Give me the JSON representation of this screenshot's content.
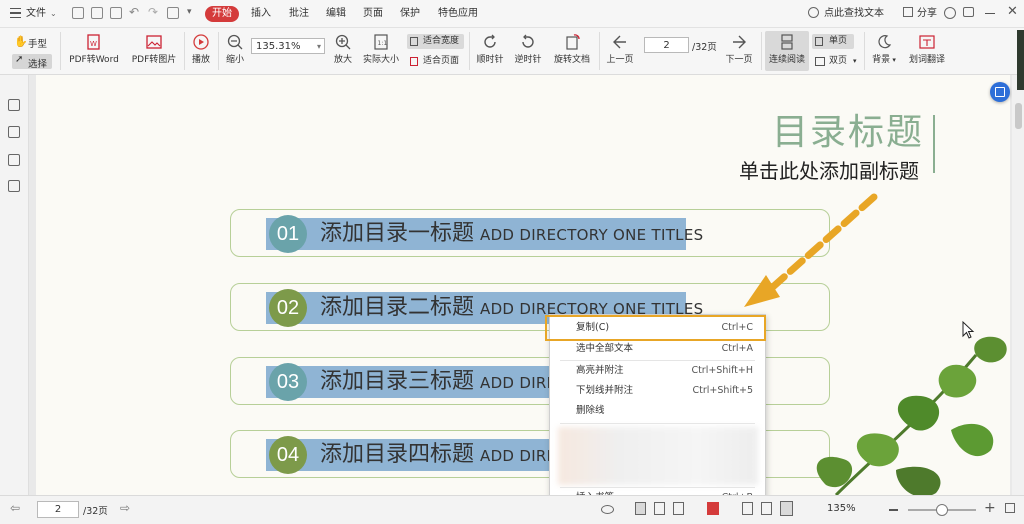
{
  "menubar": {
    "file": "文件",
    "tabs": [
      "开始",
      "插入",
      "批注",
      "编辑",
      "页面",
      "保护",
      "特色应用"
    ],
    "search": "点此查找文本",
    "share": "分享"
  },
  "toolbar": {
    "hand": "手型",
    "select": "选择",
    "pdf_word": "PDF转Word",
    "pdf_image": "PDF转图片",
    "play": "播放",
    "zoom_out": "缩小",
    "zoom_value": "135.31%",
    "zoom_in": "放大",
    "actual_size": "实际大小",
    "fit_width": "适合宽度",
    "fit_page": "适合页面",
    "rotate_cw": "顺时针",
    "rotate_ccw": "逆时针",
    "rotate_doc": "旋转文档",
    "prev_page": "上一页",
    "page_current": "2",
    "page_total": "/32页",
    "next_page": "下一页",
    "continuous": "连续阅读",
    "single": "单页",
    "double": "双页",
    "background": "背景",
    "translate": "划词翻译"
  },
  "document": {
    "title": "目录标题",
    "subtitle": "单击此处添加副标题",
    "items": [
      {
        "num": "01",
        "cn": "添加目录一标题",
        "en": "ADD DIRECTORY ONE TITLES"
      },
      {
        "num": "02",
        "cn": "添加目录二标题",
        "en": "ADD DIRECTORY ONE TITLES"
      },
      {
        "num": "03",
        "cn": "添加目录三标题",
        "en": "ADD DIRE"
      },
      {
        "num": "04",
        "cn": "添加目录四标题",
        "en": "ADD DIRE"
      }
    ]
  },
  "context_menu": {
    "copy": "复制(C)",
    "copy_key": "Ctrl+C",
    "select_all": "选中全部文本",
    "select_all_key": "Ctrl+A",
    "highlight": "高亮并附注",
    "highlight_key": "Ctrl+Shift+H",
    "underline": "下划线并附注",
    "underline_key": "Ctrl+Shift+5",
    "strike": "删除线",
    "bookmark": "插入书签",
    "bookmark_key": "Ctrl+B"
  },
  "statusbar": {
    "page_current": "2",
    "page_total": "/32页",
    "zoom": "135%"
  },
  "colors": {
    "accent_red": "#d43b3b",
    "title_green": "#8aae91",
    "highlight_blue": "#8fb4d4",
    "arrow_orange": "#e8a626",
    "box_outline": "#b7cf98"
  }
}
